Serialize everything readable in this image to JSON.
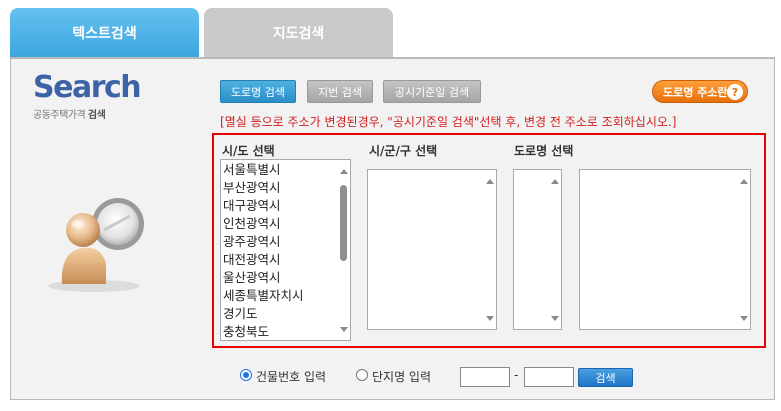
{
  "tabs": [
    {
      "label": "텍스트검색",
      "active": true
    },
    {
      "label": "지도검색",
      "active": false
    }
  ],
  "logo": {
    "title": "Search",
    "subtitle_prefix": "공동주택가격",
    "subtitle_suffix": "검색"
  },
  "search_mode_buttons": {
    "road": "도로명 검색",
    "lot": "지번 검색",
    "date": "공시기준일 검색"
  },
  "guide_button": {
    "label": "도로명 주소란",
    "icon": "?"
  },
  "notice": "[멸실 등으로 주소가 변경된경우, \"공시기준일 검색\"선택 후, 변경 전 주소로 조회하십시오.]",
  "columns": {
    "sido": "시/도 선택",
    "sigungu": "시/군/구 선택",
    "road": "도로명 선택"
  },
  "sido_list": [
    "서울특별시",
    "부산광역시",
    "대구광역시",
    "인천광역시",
    "광주광역시",
    "대전광역시",
    "울산광역시",
    "세종특별자치시",
    "경기도",
    "충청북도"
  ],
  "bottom": {
    "radio_building": "건물번호 입력",
    "radio_complex": "단지명 입력",
    "dash": "-",
    "search_button": "검색"
  },
  "colors": {
    "accent_blue": "#3da6df",
    "highlight_red": "#e60000",
    "guide_orange": "#e6700b"
  }
}
